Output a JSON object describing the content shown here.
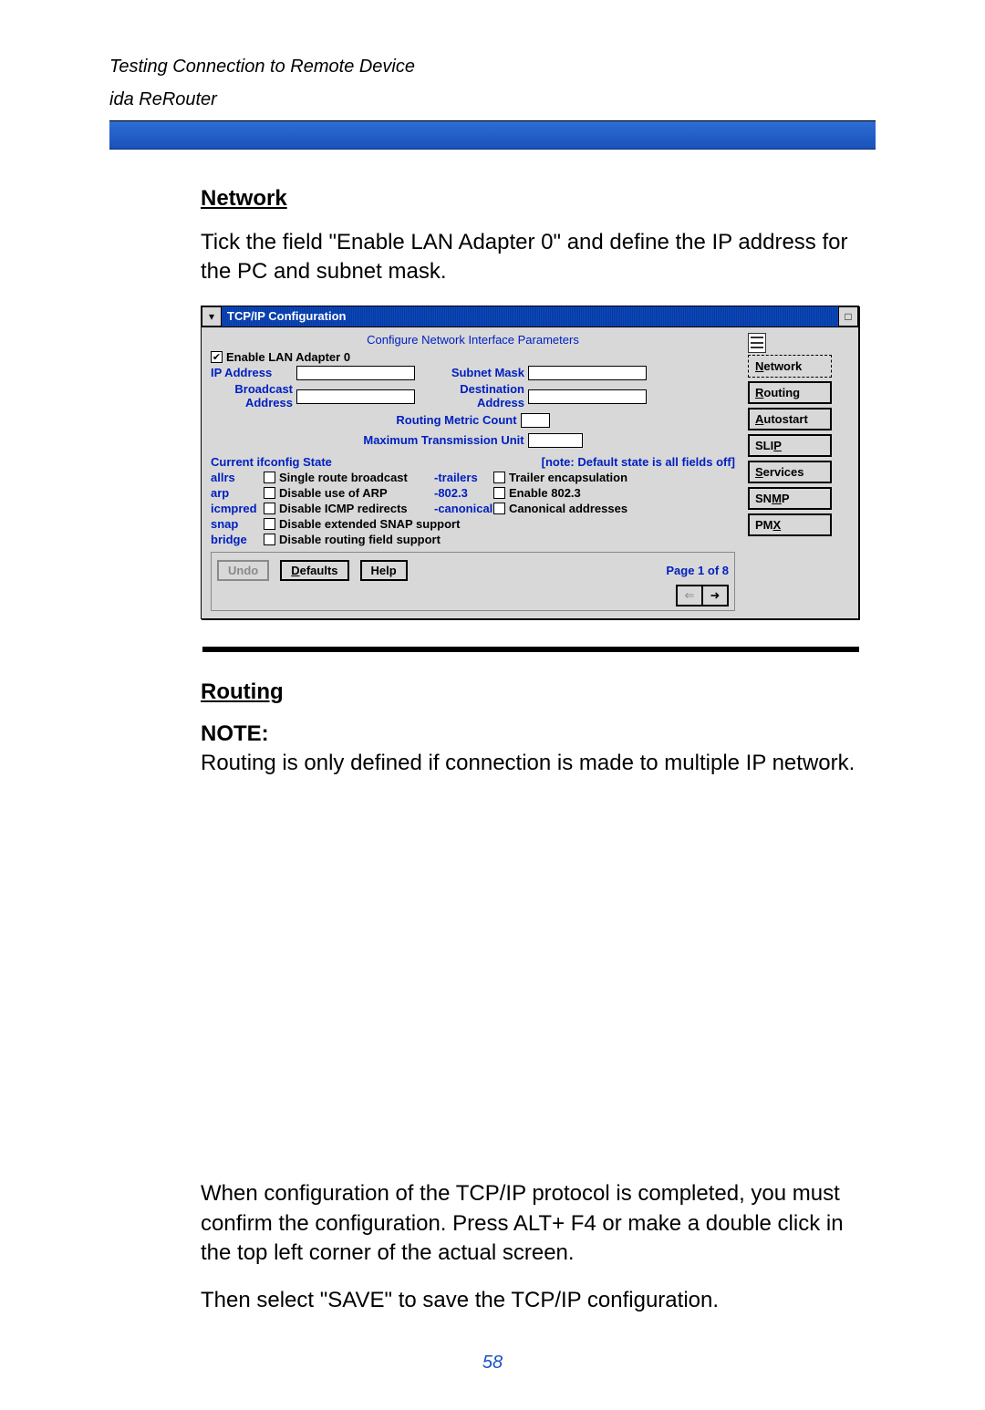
{
  "header": {
    "line1": "Testing Connection to Remote Device",
    "line2": "ida ReRouter"
  },
  "sections": {
    "network": {
      "heading": "Network",
      "intro": "Tick the field \"Enable LAN Adapter 0\" and define the IP address for the PC and subnet mask."
    },
    "routing": {
      "heading": "Routing",
      "note_label": "NOTE:",
      "note_text": "Routing is only defined if connection is made to multiple IP network.",
      "para1": "When configuration of the TCP/IP protocol is completed, you must confirm the configuration. Press ALT+ F4 or make a double click in the top left corner of the actual screen.",
      "para2": "Then select \"SAVE\" to save the TCP/IP configuration."
    }
  },
  "window": {
    "title": "TCP/IP Configuration",
    "page_title": "Configure  Network  Interface  Parameters",
    "enable_lan": "Enable LAN Adapter 0",
    "enable_lan_checked": "✔",
    "labels": {
      "ip_address": "IP Address",
      "subnet_mask": "Subnet Mask",
      "broadcast_address1": "Broadcast",
      "broadcast_address2": "Address",
      "destination_address1": "Destination",
      "destination_address2": "Address",
      "routing_metric": "Routing Metric Count",
      "mtu": "Maximum Transmission Unit",
      "ifconfig_state": "Current ifconfig State",
      "ifconfig_note": "[note:   Default state is all fields off]"
    },
    "flags": [
      {
        "key": "allrs",
        "opt": "Single route broadcast",
        "val": "-trailers",
        "opt2": "Trailer encapsulation"
      },
      {
        "key": "arp",
        "opt": "Disable use of ARP",
        "val": "-802.3",
        "opt2": "Enable 802.3"
      },
      {
        "key": "icmpred",
        "opt": "Disable ICMP redirects",
        "val": "-canonical",
        "opt2": "Canonical addresses"
      },
      {
        "key": "snap",
        "opt": "Disable extended SNAP support",
        "val": "",
        "opt2": ""
      },
      {
        "key": "bridge",
        "opt": "Disable routing field support",
        "val": "",
        "opt2": ""
      }
    ],
    "buttons": {
      "undo": "Undo",
      "defaults": "Defaults",
      "help": "Help",
      "page_indicator": "Page 1 of 8"
    },
    "side_tabs": {
      "network": "Network",
      "routing": "Routing",
      "autostart": "Autostart",
      "slip": "SLIP",
      "services": "Services",
      "snmp": "SNMP",
      "pmx": "PMX"
    },
    "arrows": {
      "left": "⇐",
      "right": "➜"
    }
  },
  "page_number": "58"
}
